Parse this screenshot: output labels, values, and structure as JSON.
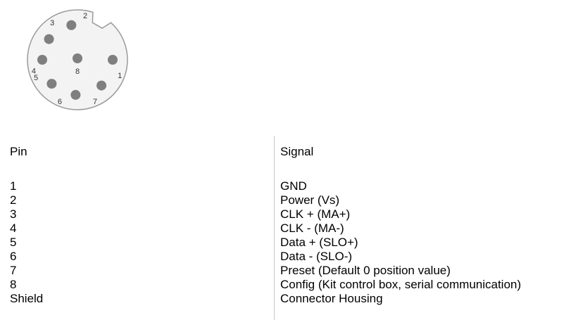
{
  "connector": {
    "pins": [
      {
        "label": "1",
        "angle": 0
      },
      {
        "label": "2",
        "angle": -100
      },
      {
        "label": "3",
        "angle": -144
      },
      {
        "label": "4",
        "angle": 180
      },
      {
        "label": "5",
        "angle": 137
      },
      {
        "label": "6",
        "angle": 93
      },
      {
        "label": "7",
        "angle": 47
      },
      {
        "label": "8",
        "angle": null
      }
    ],
    "dot_color": "#7f7f7f",
    "outline_color": "#9a9a9a",
    "fill_color": "#f3f3f3"
  },
  "table": {
    "header_pin": "Pin",
    "header_signal": "Signal",
    "rows": [
      {
        "pin": "1",
        "signal": "GND"
      },
      {
        "pin": "2",
        "signal": "Power (Vs)"
      },
      {
        "pin": "3",
        "signal": "CLK + (MA+)"
      },
      {
        "pin": "4",
        "signal": "CLK -  (MA-)"
      },
      {
        "pin": "5",
        "signal": "Data + (SLO+)"
      },
      {
        "pin": "6",
        "signal": "Data -  (SLO-)"
      },
      {
        "pin": "7",
        "signal": "Preset (Default 0 position value)"
      },
      {
        "pin": "8",
        "signal": "Config (Kit control box, serial communication)"
      },
      {
        "pin": "Shield",
        "signal": "Connector Housing"
      }
    ]
  }
}
